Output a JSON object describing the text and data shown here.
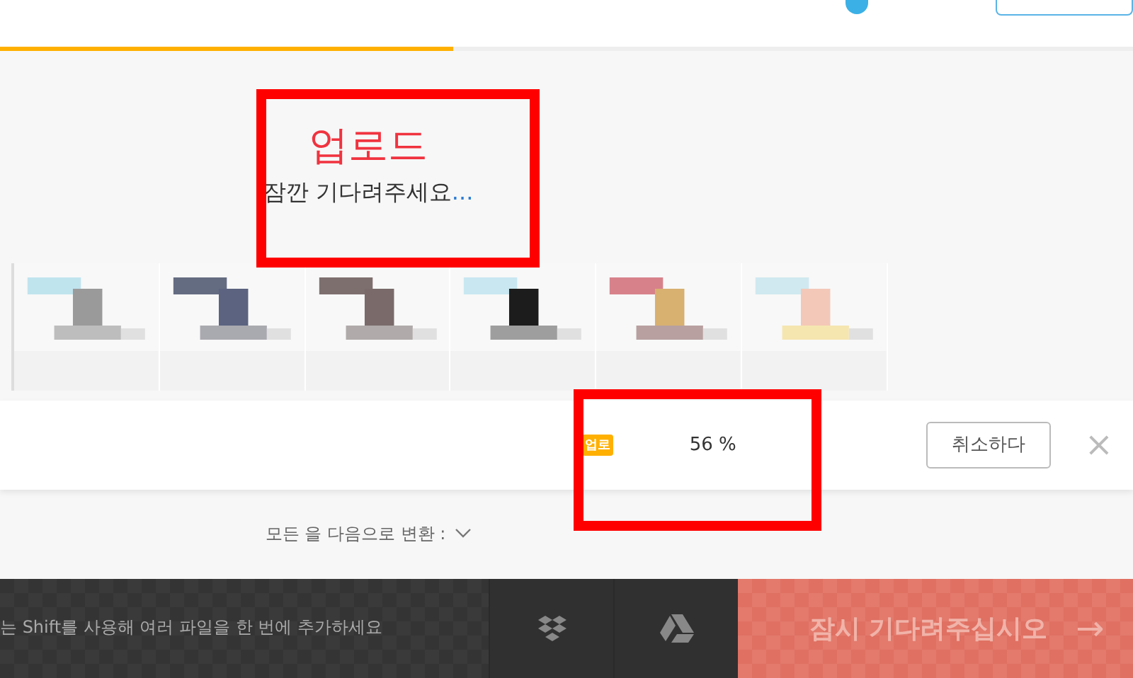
{
  "nav": {
    "progress": {
      "level": 0.4
    }
  },
  "upload": {
    "title": "업로드",
    "subtitle": "잠깐 기다려주세요",
    "ellipsis": "..."
  },
  "file_row": {
    "badge": "업로",
    "percent": "56 %",
    "cancel": "취소하다",
    "close": "×"
  },
  "convert": {
    "label": "모든 을 다음으로 변환 :"
  },
  "bottom_bar": {
    "hint": "는 Shift를 사용해 여러 파일을 한 번에 추가하세요",
    "action": "잠시 기다려주십시오",
    "arrow": "→"
  }
}
